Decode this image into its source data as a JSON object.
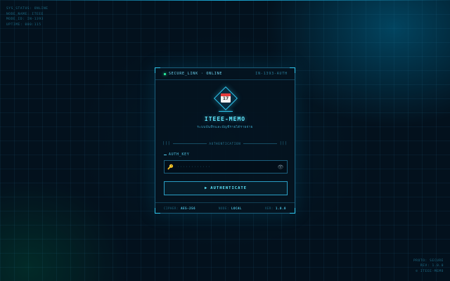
{
  "system_info": {
    "left_lines": [
      "SYS_STATUS: ONLINE",
      "NODE_NAME: ITEEE",
      "MODE_ID: IN-1393",
      "UPTIME: 000:115"
    ],
    "right_lines": [
      "PROTO: SECURE",
      "REV: 1.0.0",
      "© ITEEE-MEMO"
    ]
  },
  "panel": {
    "header": {
      "status": "SECURE_LINK · ONLINE",
      "code": "IN-1393-AUTH"
    },
    "logo": {
      "icon": "calendar-icon",
      "day": "17"
    },
    "title": "ITEEE-MEMO",
    "subtitle": "ระบบบันทึกและบัญชีรายได้รายจ่าย",
    "divider": {
      "left": "|||",
      "label": "AUTHENTICATION",
      "right": "|||"
    },
    "field": {
      "label": "AUTH_KEY",
      "placeholder": "············",
      "key_icon": "key-icon",
      "toggle_icon": "eye-icon"
    },
    "button": {
      "arrow": "▶",
      "label": "AUTHENTICATE"
    },
    "footer": {
      "cipher_label": "CIPHER:",
      "cipher_value": "AES-256",
      "node_label": "NODE:",
      "node_value": "LOCAL",
      "ver_label": "VER:",
      "ver_value": "1.0.0"
    }
  },
  "colors": {
    "accent": "#5fe8ff",
    "status_dot": "#2dffa8",
    "background": "#03111d"
  }
}
